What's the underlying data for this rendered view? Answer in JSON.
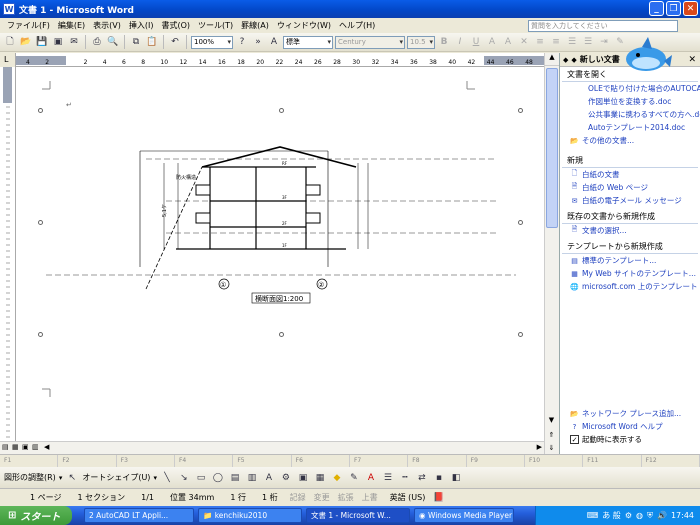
{
  "window": {
    "title": "文書 1 - Microsoft Word",
    "app_icon": "W"
  },
  "menu": [
    "ファイル(F)",
    "編集(E)",
    "表示(V)",
    "挿入(I)",
    "書式(O)",
    "ツール(T)",
    "罫線(A)",
    "ウィンドウ(W)",
    "ヘルプ(H)"
  ],
  "help_search": {
    "placeholder": "質問を入力してください"
  },
  "toolbar": {
    "zoom": "100%",
    "style": "標準",
    "font": "Century",
    "font_size": "10.5"
  },
  "ruler_numbers": [
    "4",
    "2",
    "",
    "2",
    "4",
    "6",
    "8",
    "10",
    "12",
    "14",
    "16",
    "18",
    "20",
    "22",
    "24",
    "26",
    "28",
    "30",
    "32",
    "34",
    "36",
    "38",
    "40",
    "42",
    "44",
    "46",
    "48"
  ],
  "drawing": {
    "caption": "横断面図1:200",
    "markers": [
      "①",
      "②"
    ],
    "labels": [
      "2F",
      "1F",
      "3F",
      "RF",
      "防火構造",
      "5,1ケ"
    ]
  },
  "task_pane": {
    "title": "新しい文書",
    "sections": {
      "open": "文書を開く",
      "new": "新規",
      "existing": "既存の文書から新規作成",
      "template": "テンプレートから新規作成"
    },
    "recent_files": [
      "OLEで貼り付けた場合のAUTOCAD図...",
      "作図単位を変換する.doc",
      "公共事業に携わるすべての方へ.doc",
      "Autoテンプレート2014.doc"
    ],
    "more_docs": "その他の文書...",
    "new_items": [
      "白紙の文書",
      "白紙の Web ページ",
      "白紙の電子メール メッセージ"
    ],
    "existing_items": [
      "文書の選択..."
    ],
    "template_items": [
      "標準のテンプレート...",
      "My Web サイトのテンプレート...",
      "microsoft.com 上のテンプレート"
    ],
    "footer": [
      "ネットワーク プレース追加...",
      "Microsoft Word ヘルプ"
    ],
    "show_at_startup": "起動時に表示する"
  },
  "fkeys": [
    "F1",
    "F2",
    "F3",
    "F4",
    "F5",
    "F6",
    "F7",
    "F8",
    "F9",
    "F10",
    "F11",
    "F12"
  ],
  "drawbar": {
    "draw": "図形の調整(R)",
    "autoshape": "オートシェイプ(U)"
  },
  "status": {
    "page": "1 ページ",
    "section": "1 セクション",
    "pages": "1/1",
    "position": "位置 34mm",
    "line": "1 行",
    "column": "1 桁",
    "rec": "記録",
    "trk": "変更",
    "ext": "拡張",
    "ovr": "上書",
    "lang": "英語 (US)"
  },
  "taskbar": {
    "start": "スタート",
    "tasks": [
      "2 AutoCAD LT Appli...",
      "kenchiku2010",
      "文書 1 - Microsoft W...",
      "Windows Media Player"
    ],
    "ime": "あ 般",
    "clock": "17:44"
  }
}
